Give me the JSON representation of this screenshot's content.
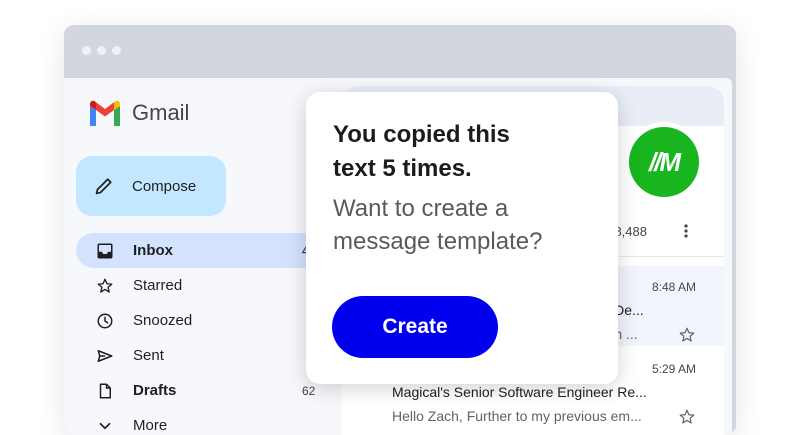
{
  "app": {
    "name": "Gmail"
  },
  "sidebar": {
    "compose_label": "Compose",
    "items": [
      {
        "label": "Inbox",
        "count": "4",
        "icon": "inbox-icon",
        "active": true
      },
      {
        "label": "Starred",
        "count": "",
        "icon": "star-icon"
      },
      {
        "label": "Snoozed",
        "count": "",
        "icon": "clock-icon"
      },
      {
        "label": "Sent",
        "count": "",
        "icon": "send-icon"
      },
      {
        "label": "Drafts",
        "count": "62",
        "icon": "draft-icon"
      },
      {
        "label": "More",
        "count": "",
        "icon": "chevron-down-icon"
      }
    ]
  },
  "main": {
    "avatar_text": "//M",
    "pagination": "of 8,488",
    "emails": [
      {
        "time": "8:48 AM",
        "subject": "r | De...",
        "snippet": "rom ..."
      },
      {
        "time": "5:29 AM",
        "subject": "Magical's Senior Software Engineer Re...",
        "snippet": "Hello Zach, Further to my previous em..."
      }
    ]
  },
  "popup": {
    "title_line1": "You copied this",
    "title_line2": "text 5 times.",
    "question_line1": "Want to create a",
    "question_line2": "message template?",
    "button_label": "Create"
  },
  "colors": {
    "compose_bg": "#c2e7ff",
    "active_nav": "#d3e3fd",
    "button_bg": "#0000ee",
    "avatar_bg": "#18b51f"
  }
}
